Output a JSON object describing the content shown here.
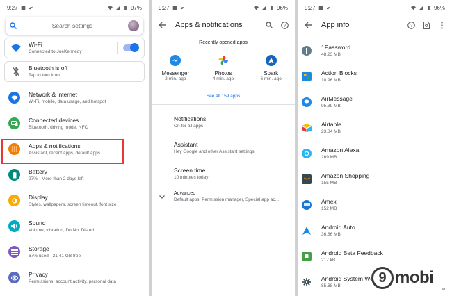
{
  "status": {
    "p1": {
      "time": "9:27",
      "battery": "97%"
    },
    "p2": {
      "time": "9:27",
      "battery": "96%"
    },
    "p3": {
      "time": "9:27",
      "battery": "96%"
    }
  },
  "settings": {
    "search_placeholder": "Search settings",
    "wifi": {
      "title": "Wi-Fi",
      "sub": "Connected to JoeKennedy"
    },
    "bluetooth": {
      "title": "Bluetooth is off",
      "sub": "Tap to turn it on"
    },
    "items": [
      {
        "title": "Network & internet",
        "sub": "Wi-Fi, mobile, data usage, and hotspot",
        "color": "#1a73e8",
        "icon": "wifi-icon"
      },
      {
        "title": "Connected devices",
        "sub": "Bluetooth, driving mode, NFC",
        "color": "#34a853",
        "icon": "devices-icon"
      },
      {
        "title": "Apps & notifications",
        "sub": "Assistant, recent apps, default apps",
        "color": "#f57c00",
        "icon": "apps-grid-icon"
      },
      {
        "title": "Battery",
        "sub": "97% - More than 2 days left",
        "color": "#00897b",
        "icon": "battery-icon"
      },
      {
        "title": "Display",
        "sub": "Styles, wallpapers, screen timeout, font size",
        "color": "#f9ab00",
        "icon": "brightness-icon"
      },
      {
        "title": "Sound",
        "sub": "Volume, vibration, Do Not Disturb",
        "color": "#00acc1",
        "icon": "volume-icon"
      },
      {
        "title": "Storage",
        "sub": "67% used - 21.41 GB free",
        "color": "#7e57c2",
        "icon": "storage-icon"
      },
      {
        "title": "Privacy",
        "sub": "Permissions, account activity, personal data",
        "color": "#5c6bc0",
        "icon": "privacy-icon"
      }
    ]
  },
  "apps_notifications": {
    "title": "Apps & notifications",
    "recent_label": "Recently opened apps",
    "recent": [
      {
        "name": "Messenger",
        "time": "2 min. ago",
        "color": "#1e88e5",
        "icon": "messenger-icon"
      },
      {
        "name": "Photos",
        "time": "4 min. ago",
        "color": "#fbbc04",
        "icon": "photos-icon"
      },
      {
        "name": "Spark",
        "time": "6 min. ago",
        "color": "#1565c0",
        "icon": "spark-icon"
      }
    ],
    "see_all": "See all 159 apps",
    "rows": [
      {
        "title": "Notifications",
        "sub": "On for all apps"
      },
      {
        "title": "Assistant",
        "sub": "Hey Google and other Assistant settings"
      },
      {
        "title": "Screen time",
        "sub": "10 minutes today"
      }
    ],
    "advanced": {
      "title": "Advanced",
      "sub": "Default apps, Permission manager, Special app ac..."
    }
  },
  "app_info": {
    "title": "App info",
    "apps": [
      {
        "name": "1Password",
        "size": "48.23 MB",
        "color": "#607d8b",
        "icon": "1password-icon"
      },
      {
        "name": "Action Blocks",
        "size": "10.96 MB",
        "color": "#1e88e5",
        "icon": "action-blocks-icon"
      },
      {
        "name": "AirMessage",
        "size": "95.39 MB",
        "color": "#1e88e5",
        "icon": "airmessage-icon"
      },
      {
        "name": "Airtable",
        "size": "23.84 MB",
        "color": "#fbbc04",
        "icon": "airtable-icon"
      },
      {
        "name": "Amazon Alexa",
        "size": "269 MB",
        "color": "#29b6f6",
        "icon": "alexa-icon"
      },
      {
        "name": "Amazon Shopping",
        "size": "155 MB",
        "color": "#37474f",
        "icon": "amazon-shopping-icon"
      },
      {
        "name": "Amex",
        "size": "152 MB",
        "color": "#1976d2",
        "icon": "amex-icon"
      },
      {
        "name": "Android Auto",
        "size": "36.86 MB",
        "color": "#1e88e5",
        "icon": "android-auto-icon"
      },
      {
        "name": "Android Beta Feedback",
        "size": "217 kB",
        "color": "#43a047",
        "icon": "beta-feedback-icon"
      },
      {
        "name": "Android System WebView",
        "size": "85.68 MB",
        "color": "#37474f",
        "icon": "webview-icon"
      }
    ]
  },
  "watermark": {
    "brand": "mobi",
    "digit": "9",
    "tld": ".vn"
  }
}
